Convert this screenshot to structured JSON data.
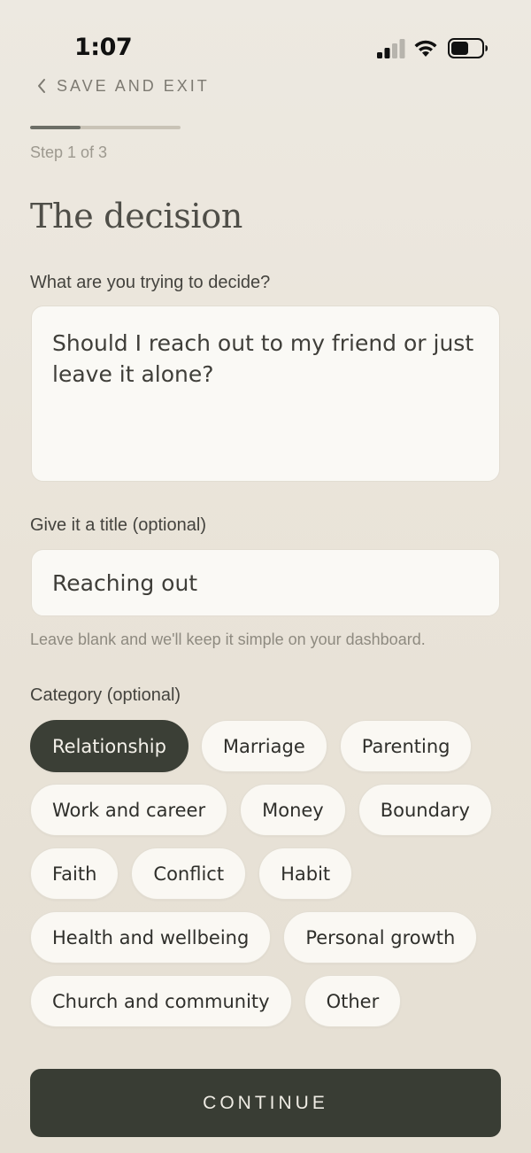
{
  "status_bar": {
    "time": "1:07"
  },
  "nav": {
    "back_label": "SAVE AND EXIT"
  },
  "progress": {
    "fraction": 0.333,
    "step_label": "Step 1 of 3"
  },
  "heading": "The decision",
  "decision_field": {
    "label": "What are you trying to decide?",
    "value": "Should I reach out to my friend or just leave it alone?"
  },
  "title_field": {
    "label": "Give it a title (optional)",
    "value": "Reaching out",
    "hint": "Leave blank and we'll keep it simple on your dashboard."
  },
  "category": {
    "label": "Category (optional)",
    "selected": "Relationship",
    "options": [
      "Relationship",
      "Marriage",
      "Parenting",
      "Work and career",
      "Money",
      "Boundary",
      "Faith",
      "Conflict",
      "Habit",
      "Health and wellbeing",
      "Personal growth",
      "Church and community",
      "Other"
    ]
  },
  "continue_label": "CONTINUE",
  "colors": {
    "background": "#ebe5da",
    "accent_dark": "#393d34",
    "card": "#faf9f5"
  },
  "icons": {
    "signal": "cellular-signal-icon",
    "wifi": "wifi-icon",
    "battery": "battery-icon",
    "back": "chevron-left-icon"
  }
}
